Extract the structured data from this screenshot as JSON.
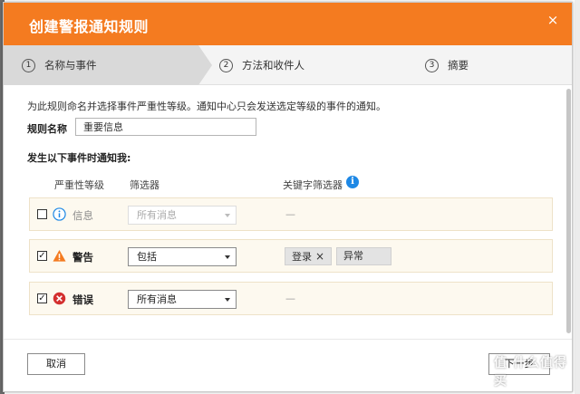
{
  "dialog": {
    "title": "创建警报通知规则",
    "close_icon": "×"
  },
  "steps": [
    {
      "num": "1",
      "label": "名称与事件"
    },
    {
      "num": "2",
      "label": "方法和收件人"
    },
    {
      "num": "3",
      "label": "摘要"
    }
  ],
  "form": {
    "description": "为此规则命名并选择事件严重性等级。通知中心只会发送选定等级的事件的通知。",
    "name_label": "规则名称",
    "name_value": "重要信息",
    "section_title": "发生以下事件时通知我:"
  },
  "columns": {
    "severity": "严重性等级",
    "filter": "筛选器",
    "keyword": "关键字筛选器"
  },
  "rows": [
    {
      "checked": "",
      "icon": "info-icon",
      "label": "信息",
      "filter": "所有消息",
      "keyword_empty": "—"
    },
    {
      "checked": "✓",
      "icon": "warning-icon",
      "label": "警告",
      "filter": "包括",
      "tags": [
        {
          "label": "登录",
          "close": "×"
        },
        {
          "label": "异常"
        }
      ]
    },
    {
      "checked": "✓",
      "icon": "error-icon",
      "label": "错误",
      "filter": "所有消息",
      "keyword_empty": "—"
    }
  ],
  "buttons": {
    "cancel": "取消",
    "next": "下一步"
  },
  "colors": {
    "accent": "#f47b20",
    "info": "#1e88e5",
    "warning": "#f47b20",
    "error": "#d32f2f"
  },
  "watermark": "值 什么值得买"
}
